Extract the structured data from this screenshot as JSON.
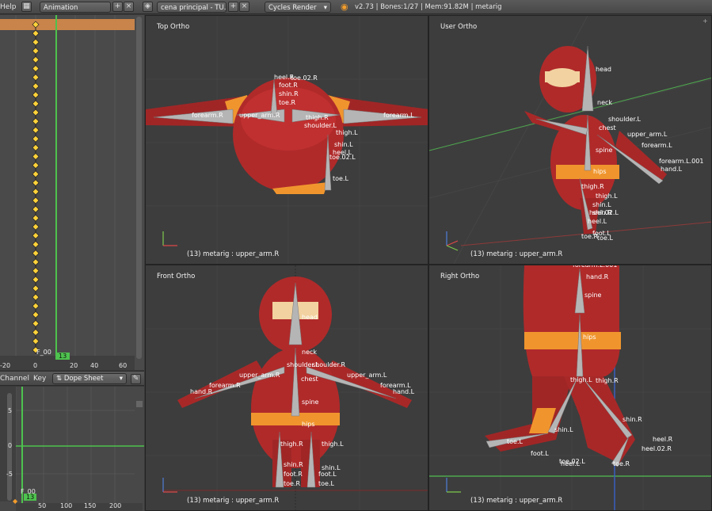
{
  "top_bar": {
    "help_menu": "Help",
    "layout_name": "Animation",
    "scene_name": "cena principal - TU...",
    "render_engine": "Cycles Render",
    "stats": "v2.73 | Bones:1/27 | Mem:91.82M | metarig"
  },
  "dopesheet": {
    "current_frame_label": "F_00",
    "current_frame_badge": "13",
    "ruler_ticks": [
      "-20",
      "0",
      "20",
      "40",
      "60"
    ]
  },
  "graph_header": {
    "channel_menu": "Channel",
    "key_menu": "Key",
    "mode_select": "Dope Sheet"
  },
  "graph": {
    "y_ticks": [
      "5",
      "0",
      "-5"
    ],
    "x_ticks": [
      "50",
      "100",
      "150",
      "200"
    ],
    "frame_label": "F_00",
    "frame_badge": "13"
  },
  "viewports": {
    "top": {
      "title": "Top Ortho",
      "status": "(13) metarig : upper_arm.R"
    },
    "user": {
      "title": "User Ortho",
      "status": "(13) metarig : upper_arm.R"
    },
    "front": {
      "title": "Front Ortho",
      "status": "(13) metarig : upper_arm.R"
    },
    "right": {
      "title": "Right Ortho",
      "status": "(13) metarig : upper_arm.R"
    }
  },
  "bone_labels": {
    "top": [
      "heel.R",
      "foot.R",
      "toe.02.R",
      "shin.R",
      "toe.R",
      "upper_arm.R",
      "forearm.R",
      "thigh.R",
      "thigh.L",
      "shin.L",
      "heel.L",
      "toe.02.L",
      "toe.L",
      "shoulder.L",
      "forearm.L"
    ],
    "user": [
      "head",
      "neck",
      "shoulder.L",
      "chest",
      "upper_arm.L",
      "spine",
      "forearm.L",
      "forearm.L.001",
      "hand.L",
      "hips",
      "thigh.R",
      "thigh.L",
      "shin.L",
      "shin.R",
      "heel.02.L",
      "heel.L",
      "toe.R",
      "foot.L",
      "toe.L"
    ],
    "front": [
      "head",
      "neck",
      "shoulder.L",
      "shoulder.R",
      "upper_arm.R",
      "upper_arm.L",
      "chest",
      "forearm.R",
      "forearm.L",
      "hand.R",
      "hand.L",
      "spine",
      "hips",
      "thigh.R",
      "thigh.L",
      "shin.R",
      "shin.L",
      "foot.R",
      "foot.L",
      "toe.R",
      "toe.L"
    ],
    "right": [
      "forearm.L.001",
      "hand.R",
      "spine",
      "hips",
      "thigh.L",
      "thigh.R",
      "shin.L",
      "shin.R",
      "heel.R",
      "heel.02.R",
      "toe.L",
      "foot.L",
      "toe.02.L",
      "heel.L",
      "toe.R"
    ]
  },
  "colors": {
    "body_red": "#b02a2a",
    "belt_orange": "#f0952e",
    "bone_gray": "#a8a8a8",
    "keyframe_yellow": "#ffd23a",
    "frame_line_green": "#4ec24e",
    "selection_orange": "#c8844a"
  },
  "icons": {
    "blender": "blender-icon",
    "layout": "screen-layout-icon",
    "scene": "scene-icon"
  }
}
